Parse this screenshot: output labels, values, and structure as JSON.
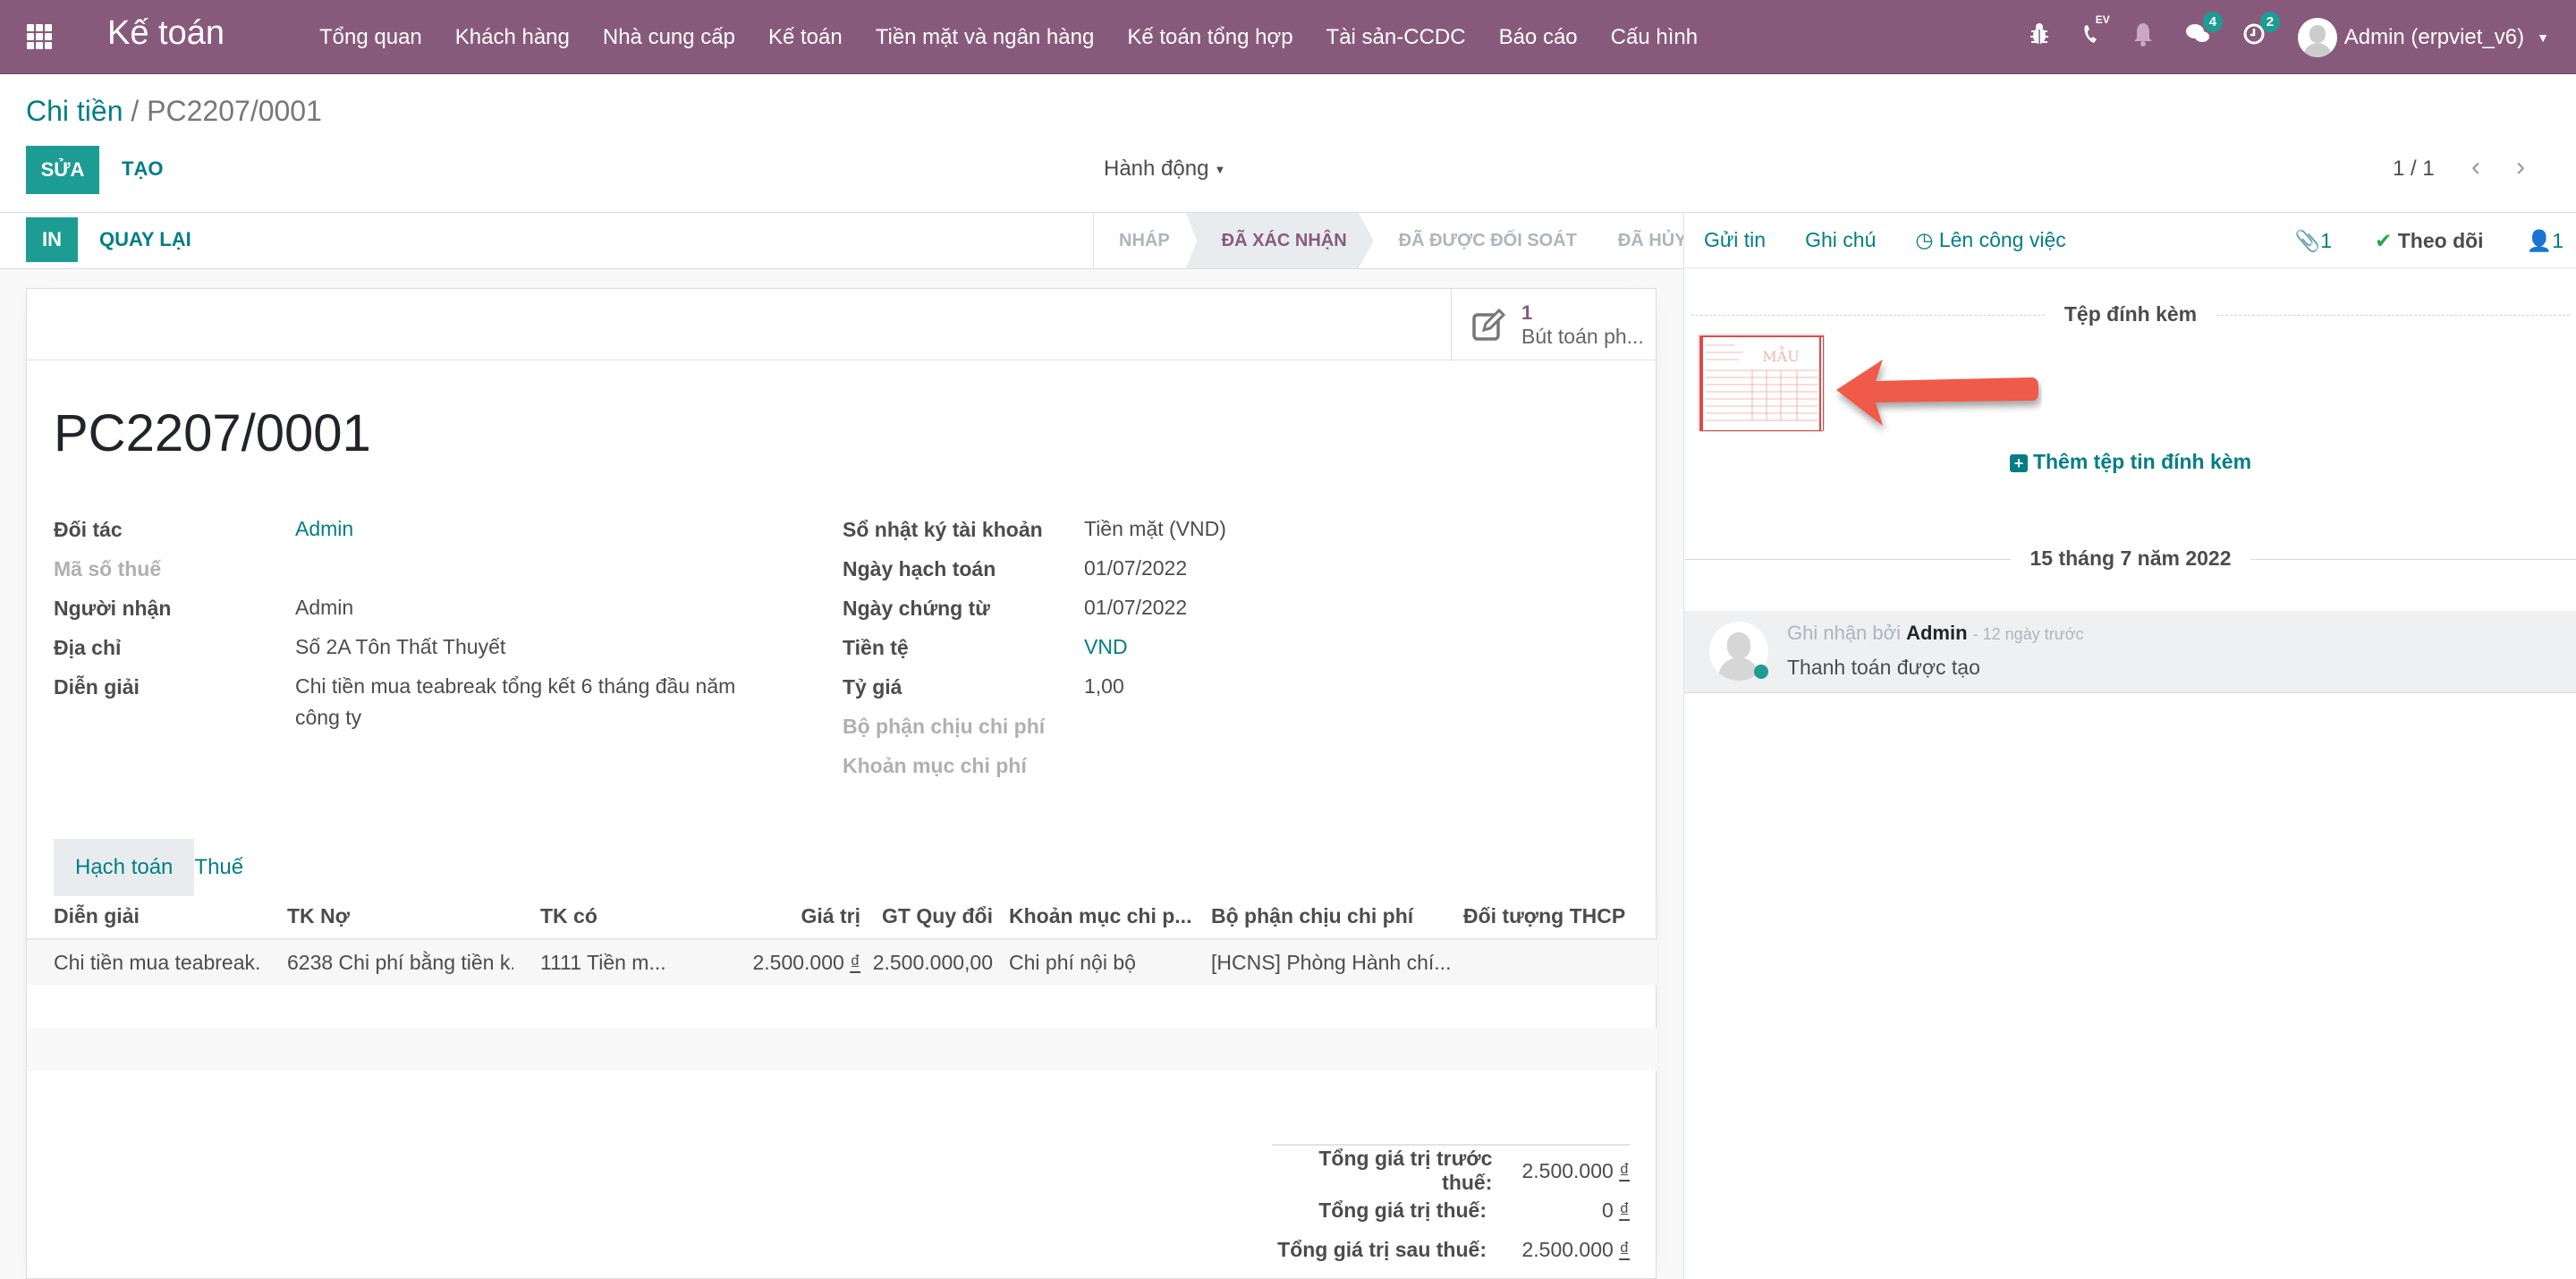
{
  "navbar": {
    "app_title": "Kế toán",
    "menu": [
      "Tổng quan",
      "Khách hàng",
      "Nhà cung cấp",
      "Kế toán",
      "Tiền mặt và ngân hàng",
      "Kế toán tổng hợp",
      "Tài sản-CCDC",
      "Báo cáo",
      "Cấu hình"
    ],
    "systray": {
      "phone_label": "EV",
      "messages_count": "4",
      "activities_count": "2",
      "user_name": "Admin (erpviet_v6)"
    },
    "color": "#875A7B"
  },
  "breadcrumb": {
    "parent": "Chi tiền",
    "separator": "/",
    "current": "PC2207/0001"
  },
  "control_panel": {
    "edit_label": "SỬA",
    "create_label": "TẠO",
    "action_label": "Hành động",
    "pager": "1 / 1"
  },
  "header": {
    "print_label": "IN",
    "back_label": "QUAY LẠI",
    "statuses": [
      {
        "label": "NHÁP",
        "active": false
      },
      {
        "label": "ĐÃ XÁC NHẬN",
        "active": true
      },
      {
        "label": "ĐÃ ĐƯỢC ĐỐI SOÁT",
        "active": false
      },
      {
        "label": "ĐÃ HỦY",
        "active": false
      }
    ]
  },
  "smart_button": {
    "count": "1",
    "label": "Bút toán ph..."
  },
  "record": {
    "title": "PC2207/0001",
    "left_fields": [
      {
        "label": "Đối tác",
        "value": "Admin",
        "link": true,
        "muted": false
      },
      {
        "label": "Mã số thuế",
        "value": "",
        "link": false,
        "muted": true
      },
      {
        "label": "Người nhận",
        "value": "Admin",
        "link": false,
        "muted": false
      },
      {
        "label": "Địa chỉ",
        "value": "Số 2A Tôn Thất Thuyết",
        "link": false,
        "muted": false
      },
      {
        "label": "Diễn giải",
        "value": "Chi tiền mua teabreak tổng kết 6 tháng đầu năm công ty",
        "link": false,
        "muted": false
      }
    ],
    "right_fields": [
      {
        "label": "Sổ nhật ký tài khoản",
        "value": "Tiền mặt (VND)",
        "link": false,
        "muted": false
      },
      {
        "label": "Ngày hạch toán",
        "value": "01/07/2022",
        "link": false,
        "muted": false
      },
      {
        "label": "Ngày chứng từ",
        "value": "01/07/2022",
        "link": false,
        "muted": false
      },
      {
        "label": "Tiền tệ",
        "value": "VND",
        "link": true,
        "muted": false
      },
      {
        "label": "Tỷ giá",
        "value": "1,00",
        "link": false,
        "muted": false
      },
      {
        "label": "Bộ phận chịu chi phí",
        "value": "",
        "link": false,
        "muted": true
      },
      {
        "label": "Khoản mục chi phí",
        "value": "",
        "link": false,
        "muted": true
      }
    ]
  },
  "notebook": {
    "tabs": [
      {
        "label": "Hạch toán",
        "active": true
      },
      {
        "label": "Thuế",
        "active": false
      }
    ],
    "columns": [
      "Diễn giải",
      "TK Nợ",
      "TK có",
      "Giá trị",
      "GT Quy đổi",
      "Khoản mục chi p...",
      "Bộ phận chịu chi phí",
      "Đối tượng THCP"
    ],
    "rows": [
      {
        "description": "Chi tiền mua teabreak...",
        "debit_account": "6238 Chi phí bằng tiền k...",
        "credit_account": "1111 Tiền m...",
        "amount": "2.500.000",
        "currency_symbol": "₫",
        "converted_amount": "2.500.000,00",
        "expense_item": "Chi phí nội bộ",
        "cost_center": "[HCNS] Phòng Hành chí...",
        "cost_object": ""
      }
    ]
  },
  "totals": [
    {
      "label": "Tổng giá trị trước thuế:",
      "value": "2.500.000",
      "symbol": "₫"
    },
    {
      "label": "Tổng giá trị thuế:",
      "value": "0",
      "symbol": "₫"
    },
    {
      "label": "Tổng giá trị sau thuế:",
      "value": "2.500.000",
      "symbol": "₫"
    }
  ],
  "chatter": {
    "send_message": "Gửi tin",
    "log_note": "Ghi chú",
    "schedule_activity": "Lên công việc",
    "attachment_count": "1",
    "follow_label": "Theo dõi",
    "follower_count": "1",
    "attachments_title": "Tệp đính kèm",
    "attachment_thumb_watermark": "MẪU",
    "add_attachment": "Thêm tệp tin đính kèm",
    "date_separator": "15 tháng 7 năm 2022",
    "messages": [
      {
        "prefix": "Ghi nhận bởi",
        "author": "Admin",
        "time": "- 12 ngày trước",
        "body": "Thanh toán được tạo"
      }
    ]
  }
}
